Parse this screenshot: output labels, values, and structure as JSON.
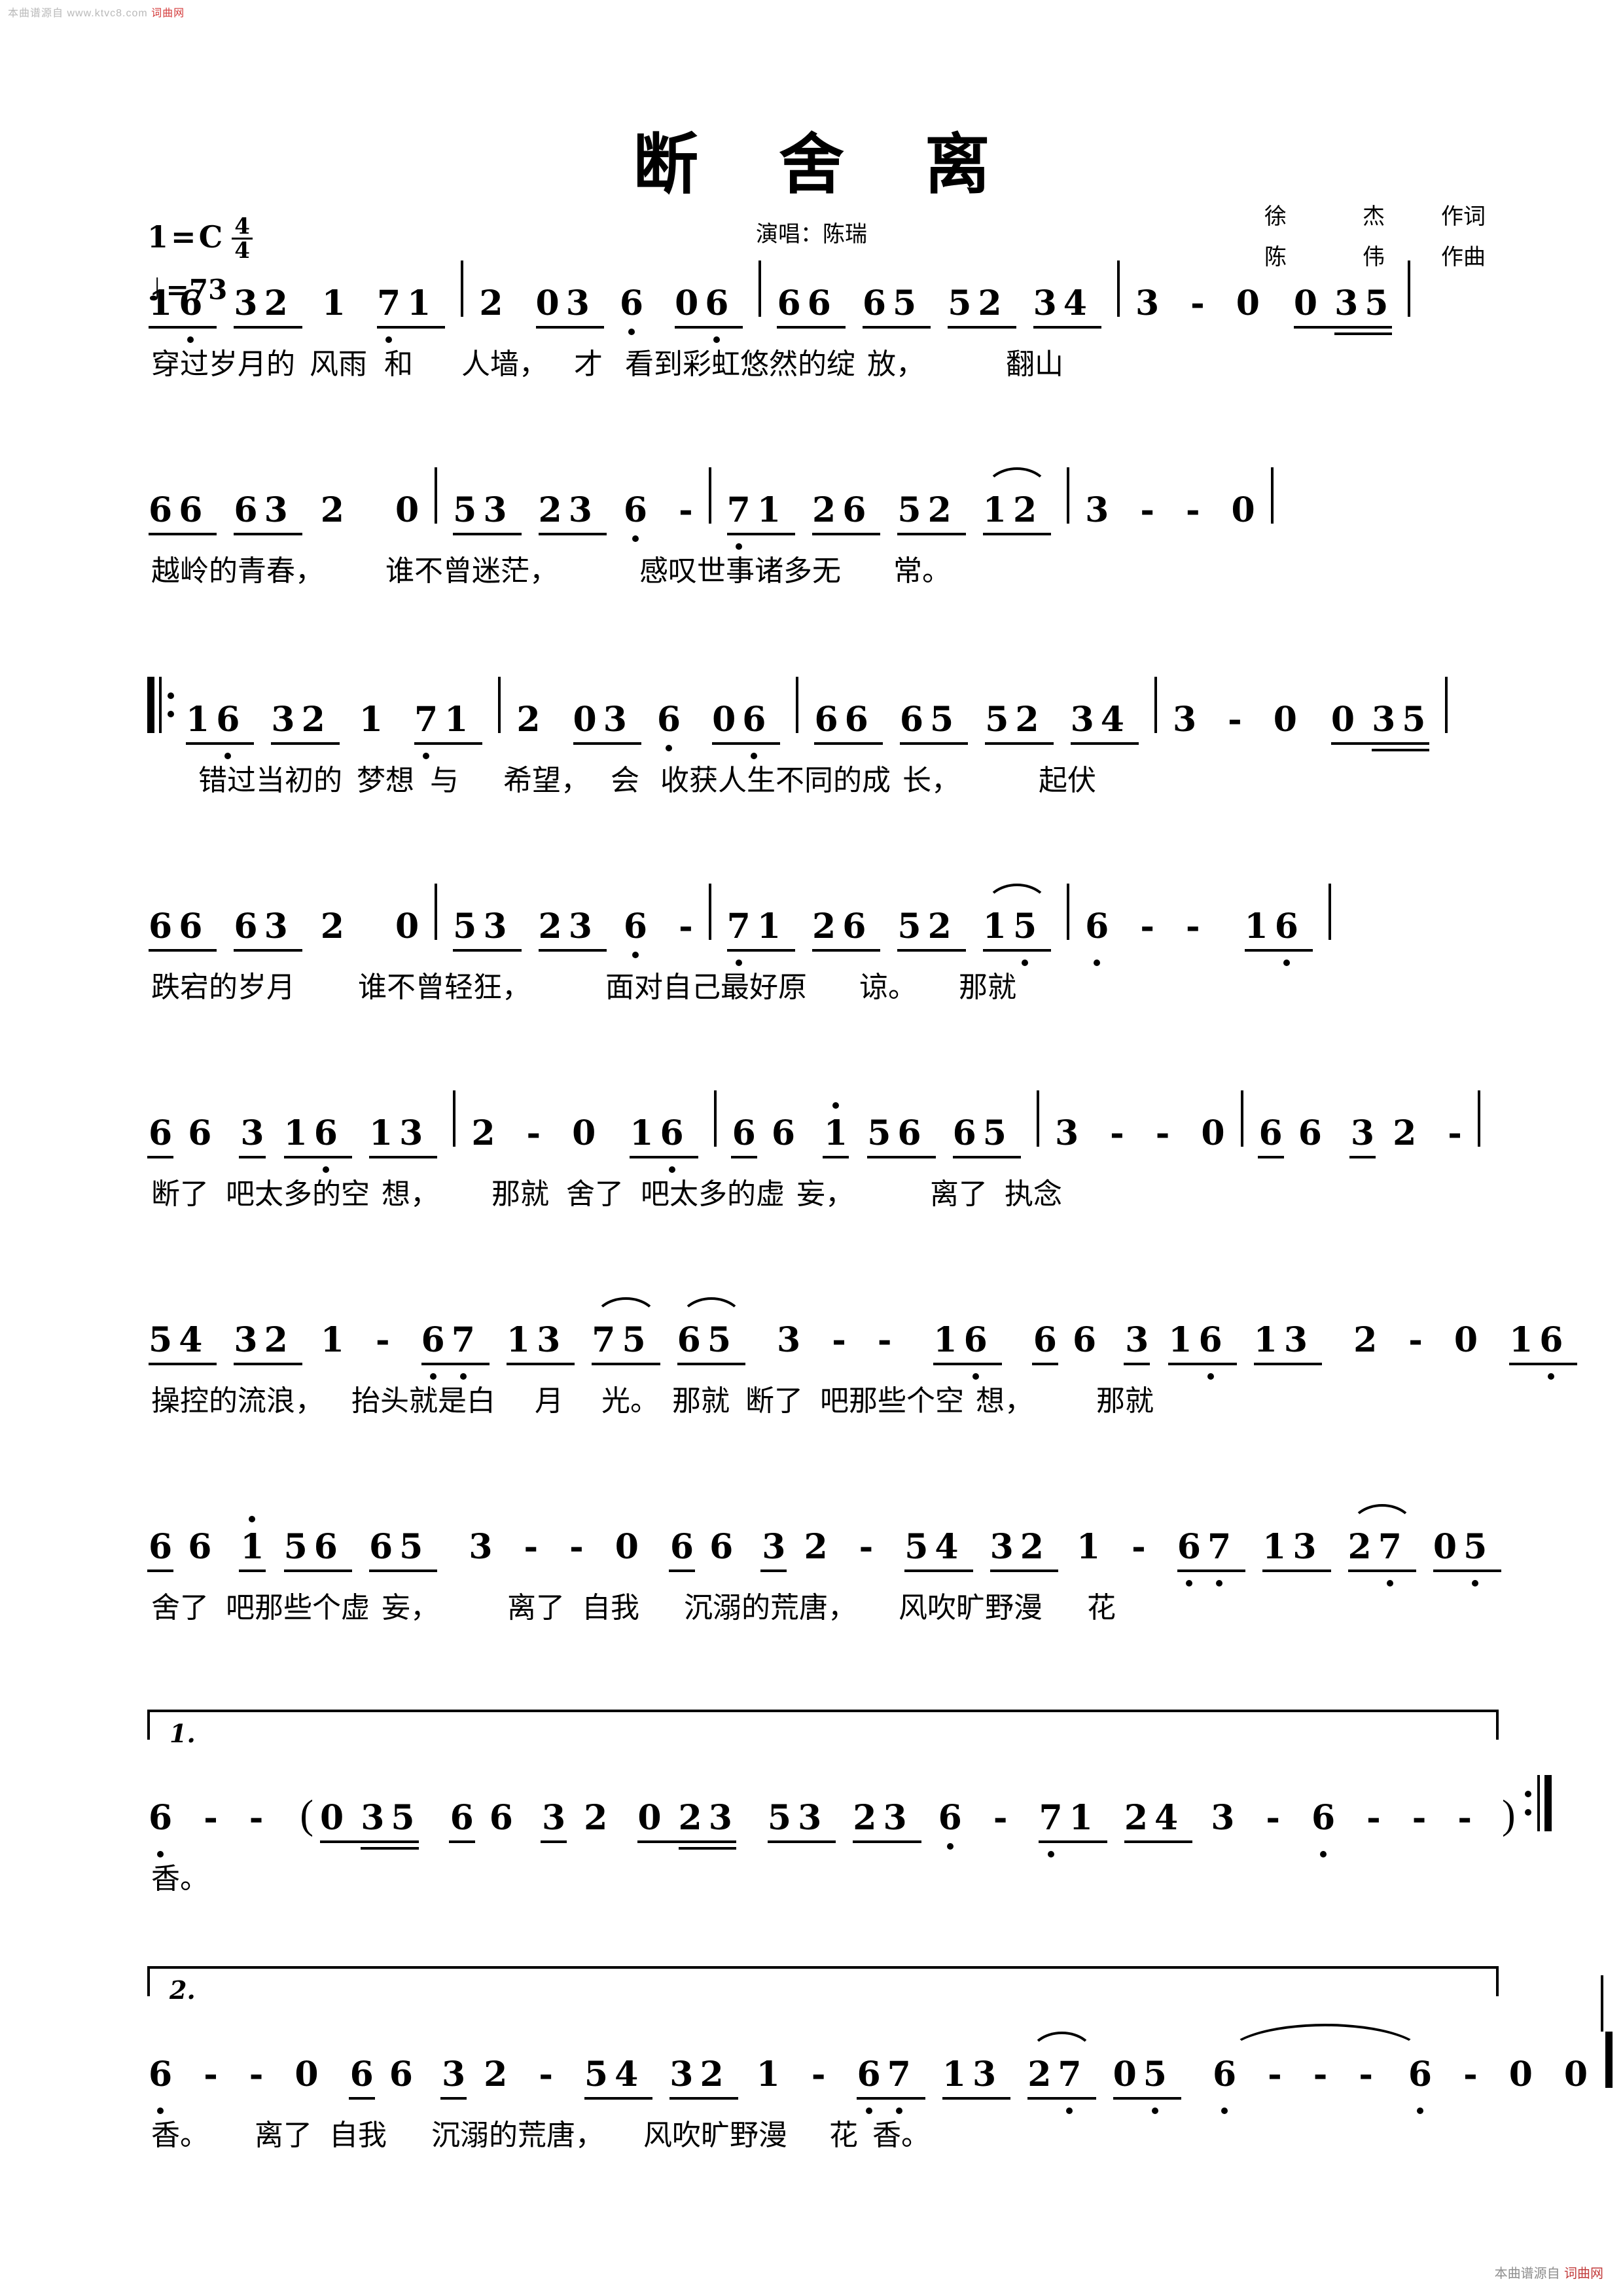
{
  "watermark": {
    "top_left_line1": "本曲谱源自",
    "top_left_line2": "www.ktvc8.com",
    "top_left_tag": "词曲网",
    "bottom_right": "本曲谱源自",
    "bottom_right_tag": "词曲网"
  },
  "header": {
    "title": "断 舍 离",
    "singer": "演唱：陈瑞",
    "lyricist_name": "徐",
    "lyricist_name2": "杰",
    "lyricist_role": "作词",
    "composer_name": "陈",
    "composer_name2": "伟",
    "composer_role": "作曲",
    "key_label": "1",
    "key_eq": "=",
    "key_value": "C",
    "time_num": "4",
    "time_den": "4",
    "tempo_note": "♩",
    "tempo_eq": "=",
    "tempo_value": "73"
  },
  "score": {
    "systems": [
      {
        "id": "system-1",
        "notes": "1 6 3 2 1  7 1 | 2  0 3 6  0 6 | 6 6 6 5 5 2 3 4 | 3 - 0  0 3 5 |",
        "lyrics": "穿过岁月的 风雨 和    人墙，  才 看到彩虹悠然的绽 放，        翻山"
      },
      {
        "id": "system-2",
        "notes": "6 6 6 3 2  0 | 5 3 2 3 6 - | 7 1 2 6 5 2 1 2 | 3 - - 0 |",
        "lyrics": "越岭的青春，    谁不曾迷茫，    感叹世事诸多无   常。"
      },
      {
        "id": "system-3",
        "notes": "‖: 1 6 3 2 1  7 1 | 2  0 3 6  0 6 | 6 6 6 5 5 2 3 4 | 3 - 0  0 3 5 |",
        "lyrics": "错过当初的 梦想 与   希望，  会 收获人生不同的成 长，       起伏"
      },
      {
        "id": "system-4",
        "notes": "6 6 6 3 2  0 | 5 3 2 3 6 - | 7 1 2 6 5 2 1 5 | 6 - - 1 6 |",
        "lyrics": "跌宕的岁月    谁不曾轻狂，    面对自己最好原   谅。  那就"
      },
      {
        "id": "system-5",
        "notes": "6 6  3 1 6 1 3 | 2 - 0  1 6 | 6 6  1 5 6 6 5 | 3 - - 0 | 6 6  3 2 - |",
        "lyrics": "断了 吧太多的空 想，   那就 舍了 吧太多的虚 妄，     离了 执念"
      },
      {
        "id": "system-6",
        "notes": "5 4 3 2 1 - | 6 7 1 3 7 5 6 5 | 3 - - 1 6 | 6 6  3 1 6 1 3 | 2 - 0  1 6 |",
        "lyrics": "操控的流浪，  抬头就是白  月  光。 那就 断了 吧那些个空 想，    那就"
      },
      {
        "id": "system-7",
        "notes": "6 6  1 5 6 6 5 | 3 - - 0 | 6 6  3 2 - | 5 4 3 2 1 - | 6 7 1 3 2 7 0 5 |",
        "lyrics": "舍了 吧那些个虚 妄，    离了 自我   沉溺的荒唐，   风吹旷野漫  花"
      },
      {
        "id": "ending-1",
        "volta": "1.",
        "notes": "6 - - ( 0 3 5 | 6 6  3 2  0 2 3 | 5 3 2 3 6 - | 7 1 2 4 3 - | 6 - - - ) :‖",
        "lyrics": "香。"
      },
      {
        "id": "ending-2",
        "volta": "2.",
        "notes": "6 - - 0 | 6 6  3 2 - | 5 4 3 2 1 - | 6 7 1 3 2 7 0 5 | 6 - - - | 6 - 0 0 ‖",
        "lyrics": "香。  离了 自我   沉溺的荒唐，  风吹旷野漫  花 香。"
      }
    ]
  },
  "lyrics_text": {
    "l1": "穿过岁月的",
    "l2": "风雨",
    "l3": "和",
    "l4": "人墙，",
    "l5": "才",
    "l6": "看到彩虹悠然的绽",
    "l7": "放，",
    "l8": "翻山",
    "l9": "越岭的青春，",
    "l10": "谁不曾迷茫，",
    "l11": "感叹世事诸多无",
    "l12": "常。",
    "l13": "错过当初的",
    "l14": "梦想",
    "l15": "与",
    "l16": "希望，",
    "l17": "会",
    "l18": "收获人生不同的成",
    "l19": "长，",
    "l20": "起伏",
    "l21": "跌宕的岁月",
    "l22": "谁不曾轻狂，",
    "l23": "面对自己最好原",
    "l24": "谅。",
    "l25": "那就",
    "l26": "断了",
    "l27": "吧太多的空",
    "l28": "想，",
    "l29": "那就",
    "l30": "舍了",
    "l31": "吧太多的虚",
    "l32": "妄，",
    "l33": "离了",
    "l34": "执念",
    "l35": "操控的流浪，",
    "l36": "抬头就是白",
    "l37": "月",
    "l38": "光。",
    "l39": "那就",
    "l40": "断了",
    "l41": "吧那些个空",
    "l42": "想，",
    "l43": "那就",
    "l44": "舍了",
    "l45": "吧那些个虚",
    "l46": "妄，",
    "l47": "离了",
    "l48": "自我",
    "l49": "沉溺的荒唐，",
    "l50": "风吹旷野漫",
    "l51": "花",
    "l52": "香。",
    "l53": "离了",
    "l54": "自我",
    "l55": "沉溺的荒唐，",
    "l56": "风吹旷野漫",
    "l57": "花",
    "l58": "香。"
  },
  "glyphs": {
    "d1": "1",
    "d2": "2",
    "d3": "3",
    "d4": "4",
    "d5": "5",
    "d6": "6",
    "d7": "7",
    "d0": "0",
    "dash": "-",
    "paren_open": "(",
    "paren_close": ")",
    "volta1": "1.",
    "volta2": "2."
  }
}
